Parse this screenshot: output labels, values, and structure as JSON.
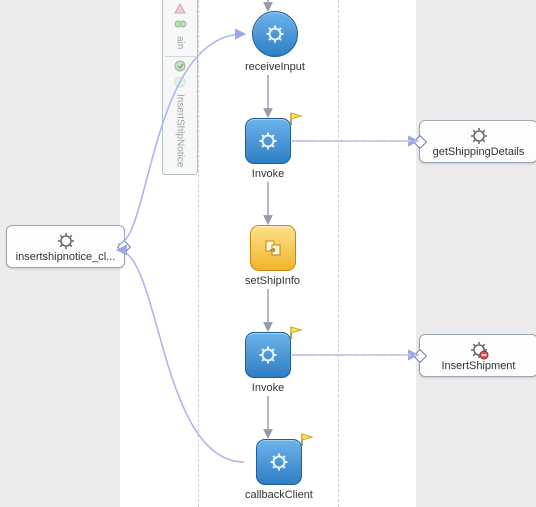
{
  "palette": {
    "label_top": "ain",
    "label_bottom": "InsertShipNotice"
  },
  "nodes": {
    "receiveInput": {
      "label": "receiveInput"
    },
    "invoke1": {
      "label": "Invoke"
    },
    "setShipInfo": {
      "label": "setShipInfo"
    },
    "invoke2": {
      "label": "Invoke"
    },
    "callbackClient": {
      "label": "callbackClient"
    }
  },
  "partners": {
    "left": {
      "label": "insertshipnotice_cl..."
    },
    "right1": {
      "label": "getShippingDetails"
    },
    "right2": {
      "label": "InsertShipment"
    }
  },
  "chart_data": {
    "type": "diagram",
    "kind": "BPEL-process",
    "sequence": [
      "receiveInput",
      "Invoke",
      "setShipInfo",
      "Invoke",
      "callbackClient"
    ],
    "partnerLinks": [
      {
        "name": "insertshipnotice_cl...",
        "side": "left",
        "targets": [
          "receiveInput",
          "callbackClient"
        ]
      },
      {
        "name": "getShippingDetails",
        "side": "right",
        "targets": [
          "Invoke[0]"
        ]
      },
      {
        "name": "InsertShipment",
        "side": "right",
        "targets": [
          "Invoke[1]"
        ]
      }
    ]
  }
}
